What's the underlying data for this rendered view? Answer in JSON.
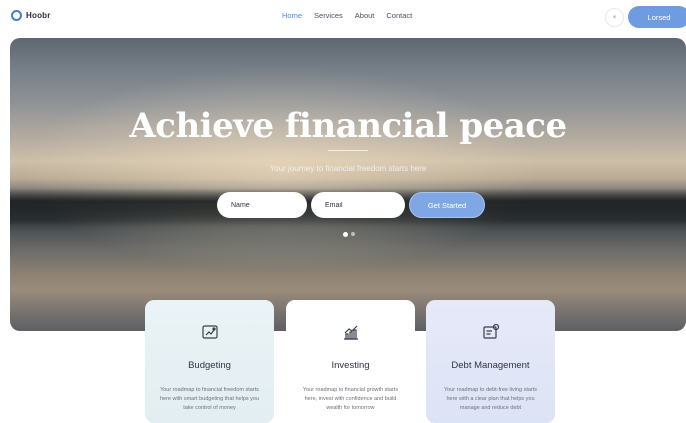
{
  "brand": {
    "name": "Hoobr"
  },
  "nav": {
    "links": [
      {
        "label": "Home",
        "active": true
      },
      {
        "label": "Services",
        "active": false
      },
      {
        "label": "About",
        "active": false
      },
      {
        "label": "Contact",
        "active": false
      }
    ],
    "close_label": "×",
    "cta_label": "Lorsed"
  },
  "hero": {
    "title": "Achieve financial peace",
    "subtitle": "Your journey to financial freedom starts here",
    "form": {
      "name_placeholder": "Name",
      "email_placeholder": "Email",
      "submit_label": "Get Started"
    },
    "carousel": {
      "dots": 2,
      "active_index": 0
    }
  },
  "services": [
    {
      "title": "Budgeting",
      "icon": "budget-chart-icon",
      "description": "Your roadmap to financial freedom starts here with smart budgeting that helps you take control of money"
    },
    {
      "title": "Investing",
      "icon": "growth-chart-icon",
      "description": "Your roadmap to financial growth starts here, invest with confidence and build wealth for tomorrow"
    },
    {
      "title": "Debt Management",
      "icon": "debt-document-icon",
      "description": "Your roadmap to debt-free living starts here with a clear plan that helps you manage and reduce debt"
    }
  ],
  "colors": {
    "accent": "#6f9be0",
    "active_link": "#4d8ae0",
    "logo_ring": "#3f7fd6",
    "card_budgeting": "#eaf3f6",
    "card_investing": "#ffffff",
    "card_debt": "#e6e9f8"
  }
}
